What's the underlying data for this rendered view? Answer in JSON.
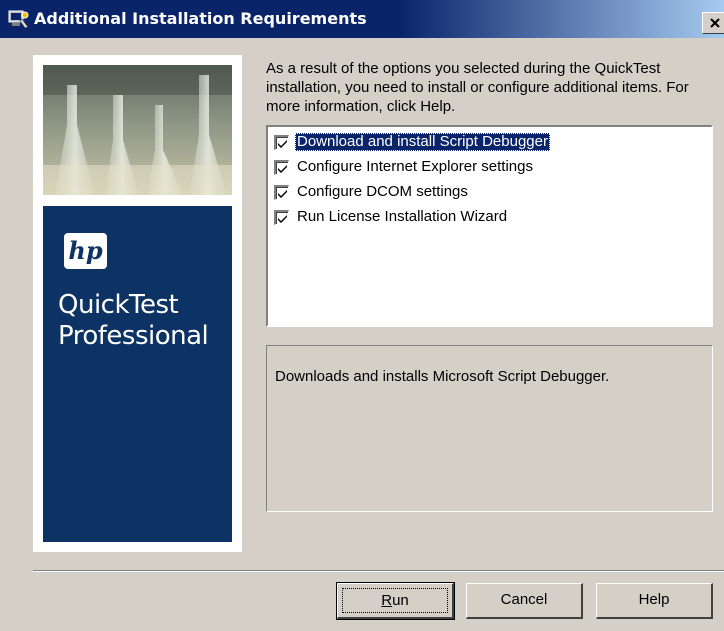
{
  "window": {
    "title": "Additional Installation Requirements"
  },
  "brand": {
    "logo_text": "hp",
    "product_name": "QuickTest\nProfessional"
  },
  "intro": {
    "text": "As a result of the options you selected during the QuickTest installation, you need to install or configure additional items. For more information, click Help."
  },
  "items": [
    {
      "label": "Download and install Script Debugger",
      "checked": true,
      "selected": true
    },
    {
      "label": "Configure Internet Explorer settings",
      "checked": true,
      "selected": false
    },
    {
      "label": "Configure DCOM settings",
      "checked": true,
      "selected": false
    },
    {
      "label": "Run License Installation Wizard",
      "checked": true,
      "selected": false
    }
  ],
  "description": {
    "text": "Downloads and installs Microsoft Script Debugger."
  },
  "buttons": {
    "run": {
      "mnemonic": "R",
      "rest": "un"
    },
    "cancel": "Cancel",
    "help": "Help"
  },
  "colors": {
    "title_bar": "#0a246a",
    "dialog_face": "#d4d0c8",
    "brand_blue": "#0c3363",
    "selection": "#0a246a"
  }
}
